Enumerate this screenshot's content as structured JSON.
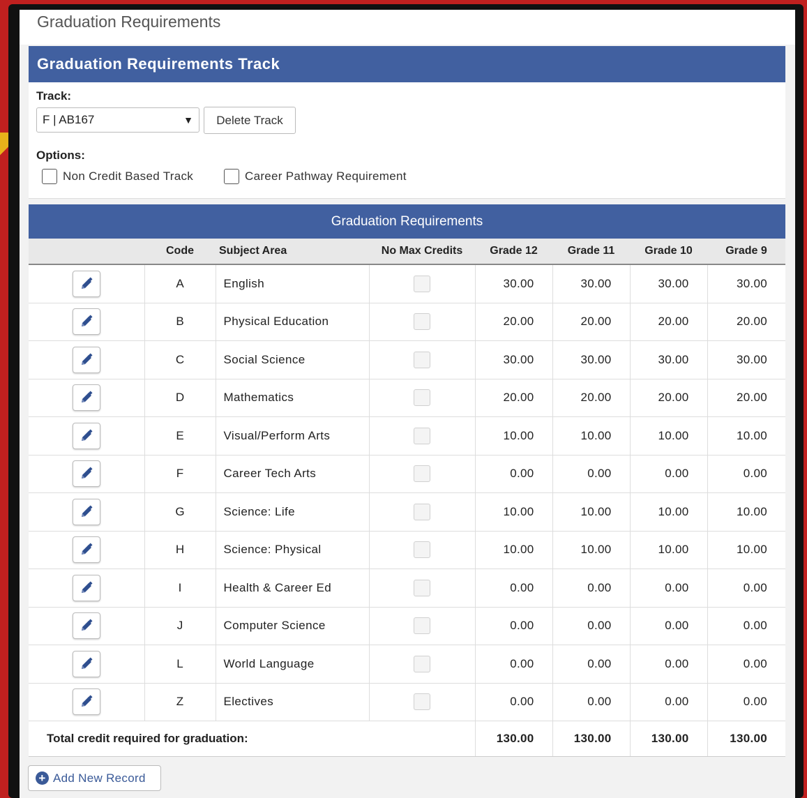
{
  "page": {
    "title": "Graduation Requirements"
  },
  "track_section": {
    "heading": "Graduation Requirements Track",
    "track_label": "Track:",
    "track_value": "F | AB167",
    "delete_label": "Delete Track",
    "options_label": "Options:",
    "options": [
      {
        "label": "Non Credit Based Track",
        "checked": false
      },
      {
        "label": "Career Pathway Requirement",
        "checked": false
      }
    ]
  },
  "grid": {
    "heading": "Graduation Requirements",
    "columns": [
      "",
      "Code",
      "Subject Area",
      "No Max Credits",
      "Grade 12",
      "Grade 11",
      "Grade 10",
      "Grade 9"
    ],
    "rows": [
      {
        "code": "A",
        "subject": "English",
        "no_max": false,
        "g12": "30.00",
        "g11": "30.00",
        "g10": "30.00",
        "g9": "30.00"
      },
      {
        "code": "B",
        "subject": "Physical Education",
        "no_max": false,
        "g12": "20.00",
        "g11": "20.00",
        "g10": "20.00",
        "g9": "20.00"
      },
      {
        "code": "C",
        "subject": "Social Science",
        "no_max": false,
        "g12": "30.00",
        "g11": "30.00",
        "g10": "30.00",
        "g9": "30.00"
      },
      {
        "code": "D",
        "subject": "Mathematics",
        "no_max": false,
        "g12": "20.00",
        "g11": "20.00",
        "g10": "20.00",
        "g9": "20.00"
      },
      {
        "code": "E",
        "subject": "Visual/Perform Arts",
        "no_max": false,
        "g12": "10.00",
        "g11": "10.00",
        "g10": "10.00",
        "g9": "10.00"
      },
      {
        "code": "F",
        "subject": "Career Tech Arts",
        "no_max": false,
        "g12": "0.00",
        "g11": "0.00",
        "g10": "0.00",
        "g9": "0.00"
      },
      {
        "code": "G",
        "subject": "Science: Life",
        "no_max": false,
        "g12": "10.00",
        "g11": "10.00",
        "g10": "10.00",
        "g9": "10.00"
      },
      {
        "code": "H",
        "subject": "Science: Physical",
        "no_max": false,
        "g12": "10.00",
        "g11": "10.00",
        "g10": "10.00",
        "g9": "10.00"
      },
      {
        "code": "I",
        "subject": "Health & Career Ed",
        "no_max": false,
        "g12": "0.00",
        "g11": "0.00",
        "g10": "0.00",
        "g9": "0.00"
      },
      {
        "code": "J",
        "subject": "Computer Science",
        "no_max": false,
        "g12": "0.00",
        "g11": "0.00",
        "g10": "0.00",
        "g9": "0.00"
      },
      {
        "code": "L",
        "subject": "World Language",
        "no_max": false,
        "g12": "0.00",
        "g11": "0.00",
        "g10": "0.00",
        "g9": "0.00"
      },
      {
        "code": "Z",
        "subject": "Electives",
        "no_max": false,
        "g12": "0.00",
        "g11": "0.00",
        "g10": "0.00",
        "g9": "0.00"
      }
    ],
    "total": {
      "label": "Total credit required for graduation:",
      "g12": "130.00",
      "g11": "130.00",
      "g10": "130.00",
      "g9": "130.00"
    }
  },
  "add_record_label": "Add New Record",
  "colors": {
    "header_blue": "#4160a0",
    "page_red": "#c0201f",
    "link_blue": "#3a5a98"
  }
}
